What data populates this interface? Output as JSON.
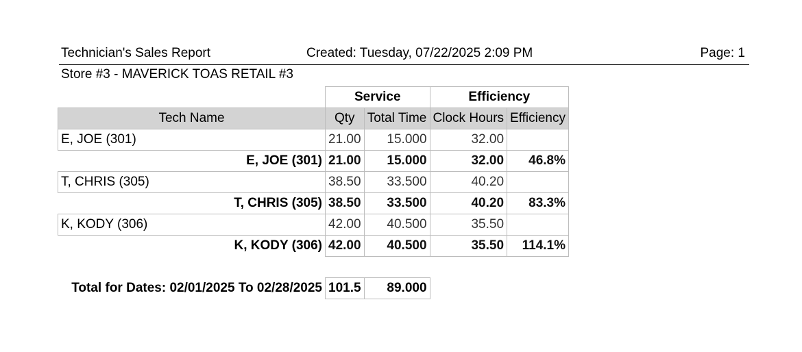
{
  "header": {
    "title": "Technician's Sales Report",
    "created": "Created: Tuesday, 07/22/2025 2:09 PM",
    "page": "Page: 1",
    "store": "Store #3 - MAVERICK TOAS RETAIL #3"
  },
  "table": {
    "group_service": "Service",
    "group_efficiency": "Efficiency",
    "col_tech_name": "Tech Name",
    "col_qty": "Qty",
    "col_total_time": "Total Time",
    "col_clock_hours": "Clock Hours",
    "col_efficiency": "Efficiency",
    "techs": [
      {
        "name": "E, JOE (301)",
        "qty": "21.00",
        "total_time": "15.000",
        "clock_hours": "32.00",
        "subtotal": {
          "name": "E, JOE (301)",
          "qty": "21.00",
          "total_time": "15.000",
          "clock_hours": "32.00",
          "efficiency": "46.8%"
        }
      },
      {
        "name": "T, CHRIS (305)",
        "qty": "38.50",
        "total_time": "33.500",
        "clock_hours": "40.20",
        "subtotal": {
          "name": "T, CHRIS (305)",
          "qty": "38.50",
          "total_time": "33.500",
          "clock_hours": "40.20",
          "efficiency": "83.3%"
        }
      },
      {
        "name": "K, KODY (306)",
        "qty": "42.00",
        "total_time": "40.500",
        "clock_hours": "35.50",
        "subtotal": {
          "name": "K, KODY (306)",
          "qty": "42.00",
          "total_time": "40.500",
          "clock_hours": "35.50",
          "efficiency": "114.1%"
        }
      }
    ],
    "total": {
      "label": "Total for Dates: 02/01/2025 To 02/28/2025",
      "qty": "101.5",
      "total_time": "89.000"
    }
  }
}
